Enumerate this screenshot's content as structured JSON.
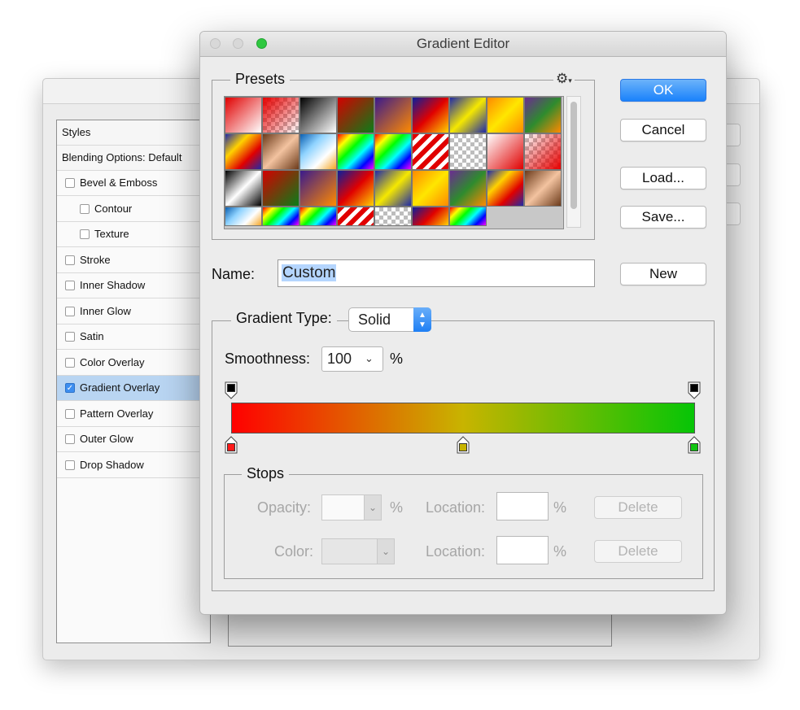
{
  "layer_style": {
    "styles_header": "Styles",
    "blending_options": "Blending Options: Default",
    "items": [
      {
        "label": "Bevel & Emboss",
        "checked": false
      },
      {
        "label": "Contour",
        "checked": false
      },
      {
        "label": "Texture",
        "checked": false
      },
      {
        "label": "Stroke",
        "checked": false
      },
      {
        "label": "Inner Shadow",
        "checked": false
      },
      {
        "label": "Inner Glow",
        "checked": false
      },
      {
        "label": "Satin",
        "checked": false
      },
      {
        "label": "Color Overlay",
        "checked": false
      },
      {
        "label": "Gradient Overlay",
        "checked": true
      },
      {
        "label": "Pattern Overlay",
        "checked": false
      },
      {
        "label": "Outer Glow",
        "checked": false
      },
      {
        "label": "Drop Shadow",
        "checked": false
      }
    ]
  },
  "editor": {
    "title": "Gradient Editor",
    "presets_label": "Presets",
    "gear_icon": "gear-icon",
    "buttons": {
      "ok": "OK",
      "cancel": "Cancel",
      "load": "Load...",
      "save": "Save...",
      "new": "New"
    },
    "name_label": "Name:",
    "name_value": "Custom",
    "gradient_type_label": "Gradient Type:",
    "gradient_type_value": "Solid",
    "smoothness_label": "Smoothness:",
    "smoothness_value": "100",
    "smoothness_unit": "%",
    "gradient": {
      "opacity_stops": [
        {
          "location": 0,
          "color": "#000000"
        },
        {
          "location": 100,
          "color": "#000000"
        }
      ],
      "color_stops": [
        {
          "location": 0,
          "color": "#ff1a1a"
        },
        {
          "location": 50,
          "color": "#c8b400"
        },
        {
          "location": 100,
          "color": "#12c412"
        }
      ]
    },
    "stops": {
      "legend": "Stops",
      "opacity_label": "Opacity:",
      "color_label": "Color:",
      "location_label": "Location:",
      "percent": "%",
      "delete_label": "Delete"
    }
  },
  "colors": {
    "accent": "#1a82fb",
    "selection": "#b9d5f2"
  }
}
